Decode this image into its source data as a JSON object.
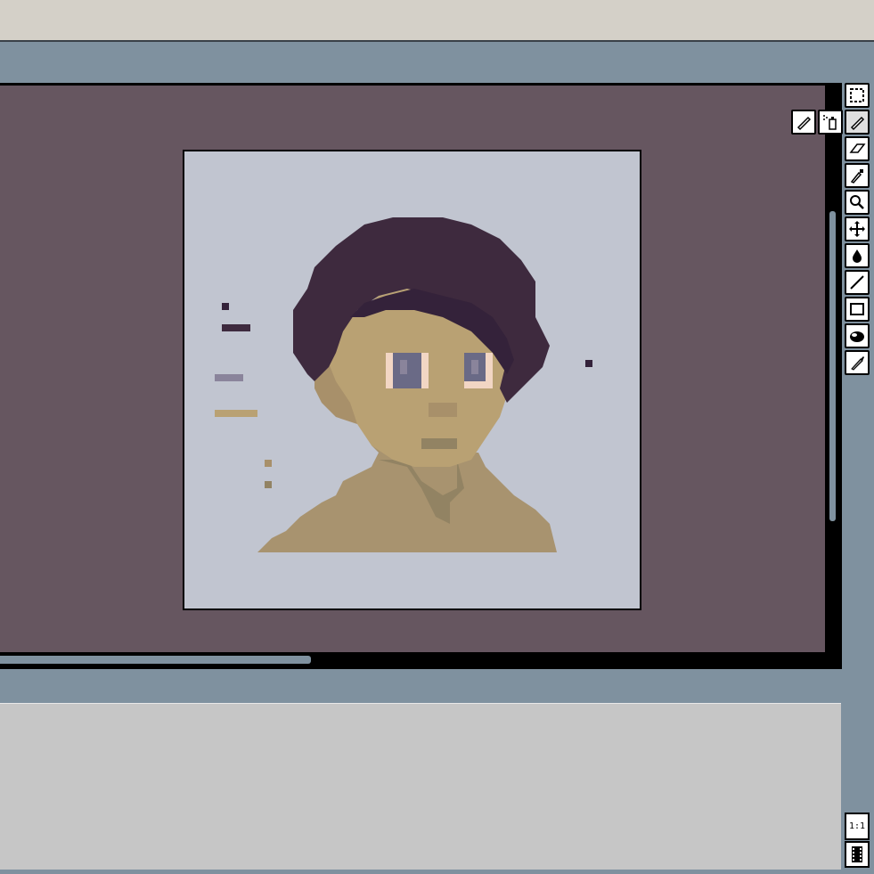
{
  "window": {
    "title": ""
  },
  "colors": {
    "workspace": "#7f919f",
    "canvas_area": "#665660",
    "sprite_background": "#c1c5d0",
    "hair": "#3e2a3e",
    "hair_shadow": "#34223a",
    "skin": "#b9a173",
    "skin_shadow": "#a8906a",
    "neck_shadow": "#928363",
    "shirt": "#a8936f",
    "eye": "#6a6a86",
    "eye_white": "#f2d6c4",
    "panel": "#c6c6c6"
  },
  "palette_swatches": [
    "#34223a",
    "#3e2a3e",
    "#8a849b",
    "#b9a173",
    "#a8906a",
    "#928363"
  ],
  "toolbar": {
    "main_tools": [
      {
        "name": "marquee-select-icon",
        "active": false
      },
      {
        "name": "pencil-icon",
        "active": true
      },
      {
        "name": "eraser-icon",
        "active": false
      },
      {
        "name": "eyedropper-icon",
        "active": false
      },
      {
        "name": "zoom-magnifier-icon",
        "active": false
      },
      {
        "name": "move-arrows-icon",
        "active": false
      },
      {
        "name": "fill-bucket-icon",
        "active": false
      },
      {
        "name": "line-icon",
        "active": false
      },
      {
        "name": "rectangle-icon",
        "active": false
      },
      {
        "name": "ellipse-filled-icon",
        "active": false
      },
      {
        "name": "brush-icon",
        "active": false
      }
    ],
    "pencil_options": [
      {
        "name": "pencil-option-icon"
      },
      {
        "name": "spray-can-icon"
      }
    ]
  },
  "zoom_button": {
    "label": "1:1"
  },
  "film_button": {
    "icon": "film-strip-icon"
  }
}
